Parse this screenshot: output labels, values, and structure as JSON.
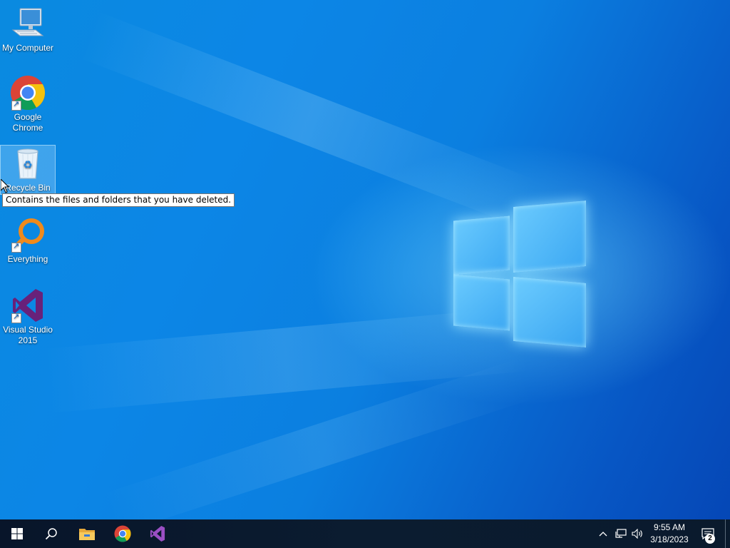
{
  "desktop": {
    "icons": [
      {
        "label_line1": "My Computer",
        "label_line2": "",
        "icon": "computer-icon"
      },
      {
        "label_line1": "Google",
        "label_line2": "Chrome",
        "icon": "chrome-icon"
      },
      {
        "label_line1": "Recycle Bin",
        "label_line2": "",
        "icon": "recycle-bin-icon"
      },
      {
        "label_line1": "Everything",
        "label_line2": "",
        "icon": "everything-search-icon"
      },
      {
        "label_line1": "Visual Studio",
        "label_line2": "2015",
        "icon": "visual-studio-icon"
      }
    ],
    "tooltip": "Contains the files and folders that you have deleted."
  },
  "taskbar": {
    "start_icon": "windows-start-icon",
    "search_icon": "search-icon",
    "pinned": [
      "file-explorer-icon",
      "chrome-icon",
      "visual-studio-icon"
    ],
    "tray": {
      "chevron_icon": "chevron-up-icon",
      "network_icon": "network-icon",
      "volume_icon": "volume-icon",
      "time": "9:55 AM",
      "date": "3/18/2023",
      "notification_count": "2"
    }
  },
  "colors": {
    "desktop_blue": "#0b7fe0",
    "taskbar": "#0b1a2b",
    "vs_purple": "#68217a",
    "chrome_red": "#db4437",
    "chrome_yellow": "#f4c20d",
    "chrome_green": "#0f9d58",
    "chrome_blue": "#4285f4",
    "everything_orange": "#f08a1c"
  }
}
